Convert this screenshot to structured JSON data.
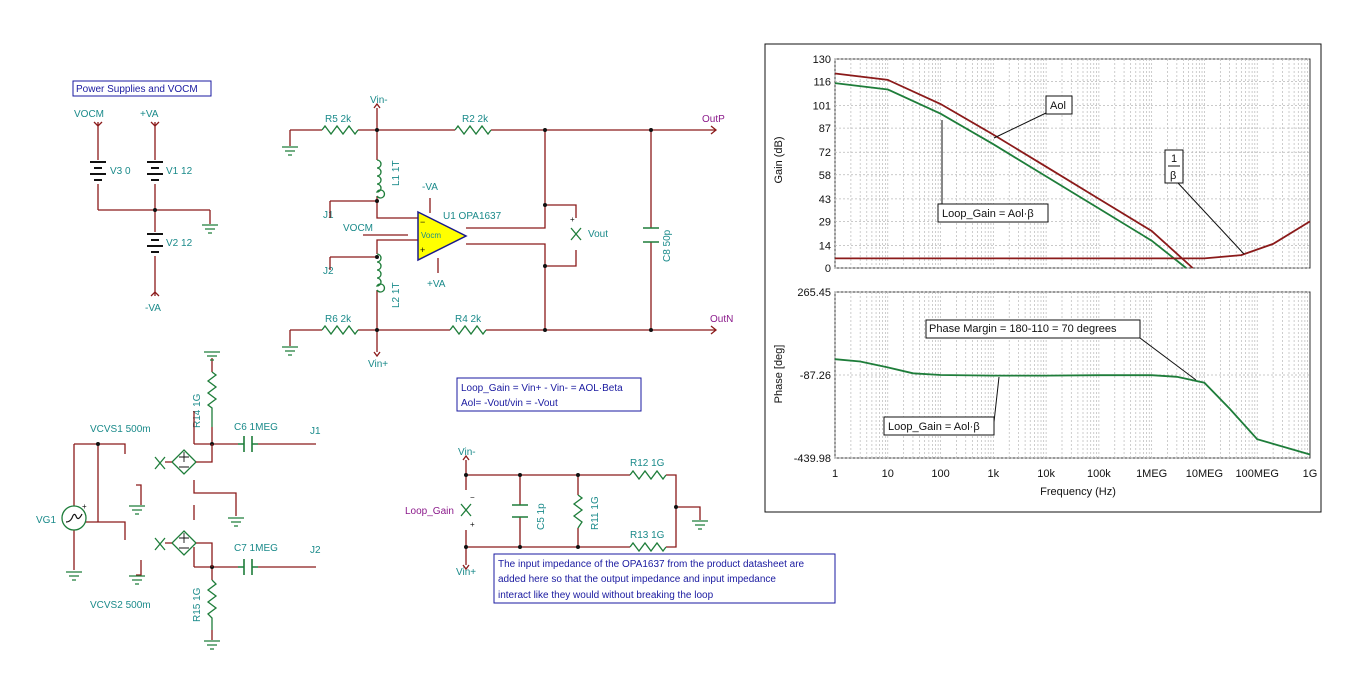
{
  "boxes": {
    "power": "Power Supplies and VOCM",
    "loop_gain_1": "Loop_Gain = Vin+ - Vin- = AOL·Beta",
    "loop_gain_2": "Aol= -Vout/vin = -Vout",
    "note_1": "The input impedance of the OPA1637 from the product datasheet are",
    "note_2": "added here so that the output impedance and input impedance",
    "note_3": "interact like they would without breaking the loop"
  },
  "power_section": {
    "vocm": "VOCM",
    "pva": "+VA",
    "nva": "-VA",
    "v3": "V3 0",
    "v1": "V1 12",
    "v2": "V2 12"
  },
  "main_circuit": {
    "vinm": "Vin-",
    "vinp": "Vin+",
    "r5": "R5 2k",
    "r2": "R2 2k",
    "r6": "R6 2k",
    "r4": "R4 2k",
    "l1": "L1 1T",
    "l2": "L2 1T",
    "j1": "J1",
    "j2": "J2",
    "vocm": "VOCM",
    "nva": "-VA",
    "pva": "+VA",
    "u1": "U1 OPA1637",
    "vocm_pin": "Vocm",
    "outp": "OutP",
    "outn": "OutN",
    "vout": "Vout",
    "c8": "C8 50p"
  },
  "source_circuit": {
    "vcvs1": "VCVS1 500m",
    "vcvs2": "VCVS2 500m",
    "vg1": "VG1",
    "r14": "R14 1G",
    "r15": "R15 1G",
    "c6": "C6 1MEG",
    "c7": "C7 1MEG",
    "j1": "J1",
    "j2": "J2"
  },
  "input_circuit": {
    "vinm": "Vin-",
    "vinp": "Vin+",
    "loop_gain": "Loop_Gain",
    "c5": "C5 1p",
    "r11": "R11 1G",
    "r12": "R12 1G",
    "r13": "R13 1G"
  },
  "chart_data": [
    {
      "type": "line",
      "x_scale": "log",
      "xlim": [
        1,
        1000000000
      ],
      "ylabel": "Gain (dB)",
      "ylim": [
        0,
        130
      ],
      "yticks": [
        "130",
        "116",
        "101",
        "87",
        "72",
        "58",
        "43",
        "29",
        "14",
        "0"
      ],
      "grid": true,
      "series": [
        {
          "name": "Aol",
          "color": "#8b1a1a",
          "x": [
            1,
            10,
            100,
            1000,
            10000,
            100000,
            1000000,
            6000000
          ],
          "y": [
            121,
            117,
            102,
            83,
            63,
            43,
            23,
            0
          ]
        },
        {
          "name": "Loop_Gain = Aol·β",
          "color": "#1e7d3a",
          "x": [
            1,
            10,
            100,
            1000,
            10000,
            100000,
            1000000,
            4500000
          ],
          "y": [
            115,
            111,
            96,
            77,
            57,
            37,
            17,
            0
          ]
        },
        {
          "name": "1/β",
          "color": "#8b1a1a",
          "x": [
            1,
            1000,
            1000000,
            10000000,
            50000000,
            200000000,
            1000000000
          ],
          "y": [
            6,
            6,
            6,
            6,
            8,
            15,
            29
          ]
        }
      ],
      "annotations": [
        "Aol",
        "Loop_Gain = Aol·β",
        "1",
        "β"
      ]
    },
    {
      "type": "line",
      "x_scale": "log",
      "xlim": [
        1,
        1000000000
      ],
      "xlabel": "Frequency (Hz)",
      "xticks": [
        "1",
        "10",
        "100",
        "1k",
        "10k",
        "100k",
        "1MEG",
        "10MEG",
        "100MEG",
        "1G"
      ],
      "ylabel": "Phase [deg]",
      "ylim": [
        -439.98,
        265.45
      ],
      "yticks": [
        "265.45",
        "-87.26",
        "-439.98"
      ],
      "grid": true,
      "series": [
        {
          "name": "Loop_Gain = Aol·β",
          "color": "#1e7d3a",
          "x": [
            1,
            3,
            10,
            30,
            100,
            1000,
            10000,
            100000,
            1000000,
            3000000,
            10000000,
            30000000,
            100000000,
            1000000000
          ],
          "y": [
            -20,
            -30,
            -55,
            -80,
            -87.26,
            -90,
            -90,
            -88,
            -88,
            -95,
            -120,
            -230,
            -360,
            -425
          ]
        }
      ],
      "annotations": [
        "Phase Margin = 180-110 = 70 degrees",
        "Loop_Gain = Aol·β"
      ]
    }
  ]
}
